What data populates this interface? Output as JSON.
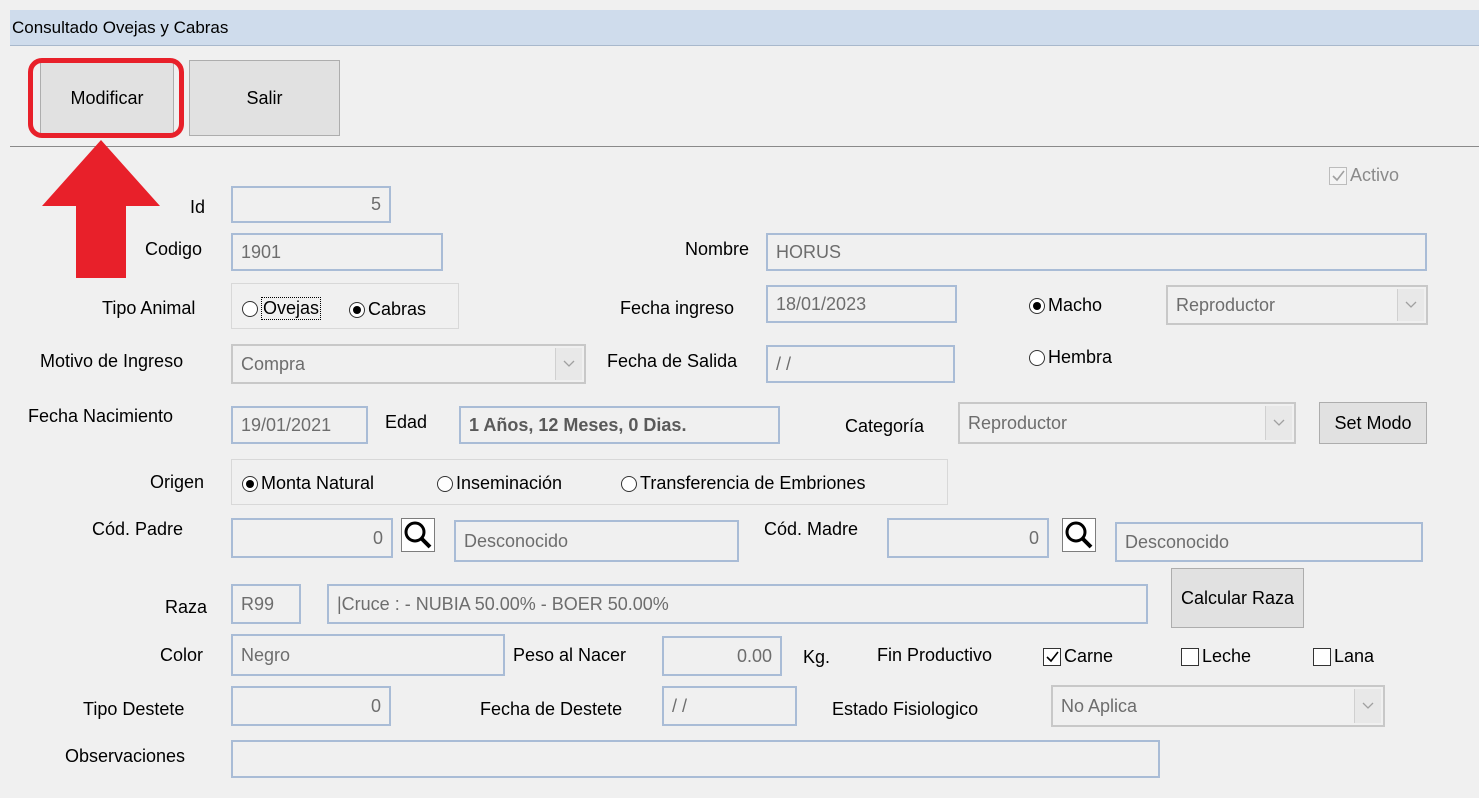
{
  "window": {
    "title": "Consultado Ovejas y Cabras"
  },
  "toolbar": {
    "modify_label": "Modificar",
    "exit_label": "Salir"
  },
  "form": {
    "activo_label": "Activo",
    "id_label": "Id",
    "id_value": "5",
    "codigo_label": "Codigo",
    "codigo_value": "1901",
    "nombre_label": "Nombre",
    "nombre_value": "HORUS",
    "tipo_animal_label": "Tipo Animal",
    "tipo_animal_options": [
      "Ovejas",
      "Cabras"
    ],
    "tipo_animal_selected": "Cabras",
    "fecha_ingreso_label": "Fecha ingreso",
    "fecha_ingreso_value": "18/01/2023",
    "sexo_options": [
      "Macho",
      "Hembra"
    ],
    "sexo_selected": "Macho",
    "tipo_macho_value": "Reproductor",
    "motivo_label": "Motivo de Ingreso",
    "motivo_value": "Compra",
    "fecha_salida_label": "Fecha de Salida",
    "fecha_salida_value": " /  /",
    "fecha_nac_label": "Fecha Nacimiento",
    "fecha_nac_value": "19/01/2021",
    "edad_label": "Edad",
    "edad_value": "1 Años, 12 Meses,  0 Dias.",
    "categoria_label": "Categoría",
    "categoria_value": "Reproductor",
    "set_modo_label": "Set Modo",
    "origen_label": "Origen",
    "origen_options": [
      "Monta Natural",
      "Inseminación",
      "Transferencia de Embriones"
    ],
    "origen_selected": "Monta Natural",
    "padre_label": "Cód. Padre",
    "padre_code": "0",
    "padre_name": "Desconocido",
    "madre_label": "Cód. Madre",
    "madre_code": "0",
    "madre_name": "Desconocido",
    "raza_label": "Raza",
    "raza_code": "R99",
    "raza_desc": "|Cruce :  - NUBIA 50.00% - BOER 50.00%",
    "calcular_raza_label": "Calcular Raza",
    "color_label": "Color",
    "color_value": "Negro",
    "peso_label": "Peso al Nacer",
    "peso_value": "0.00",
    "peso_unit": "Kg.",
    "fin_label": "Fin Productivo",
    "fin_options": [
      "Carne",
      "Leche",
      "Lana"
    ],
    "fin_checked": [
      "Carne"
    ],
    "tipo_destete_label": "Tipo Destete",
    "tipo_destete_value": "0",
    "fecha_destete_label": "Fecha de Destete",
    "fecha_destete_value": " /  /",
    "estado_label": "Estado Fisiologico",
    "estado_value": "No Aplica",
    "obs_label": "Observaciones",
    "obs_value": ""
  },
  "colors": {
    "highlight": "#e8202a",
    "titlebar": "#cfdcec",
    "field_border": "#a9bcd6"
  }
}
